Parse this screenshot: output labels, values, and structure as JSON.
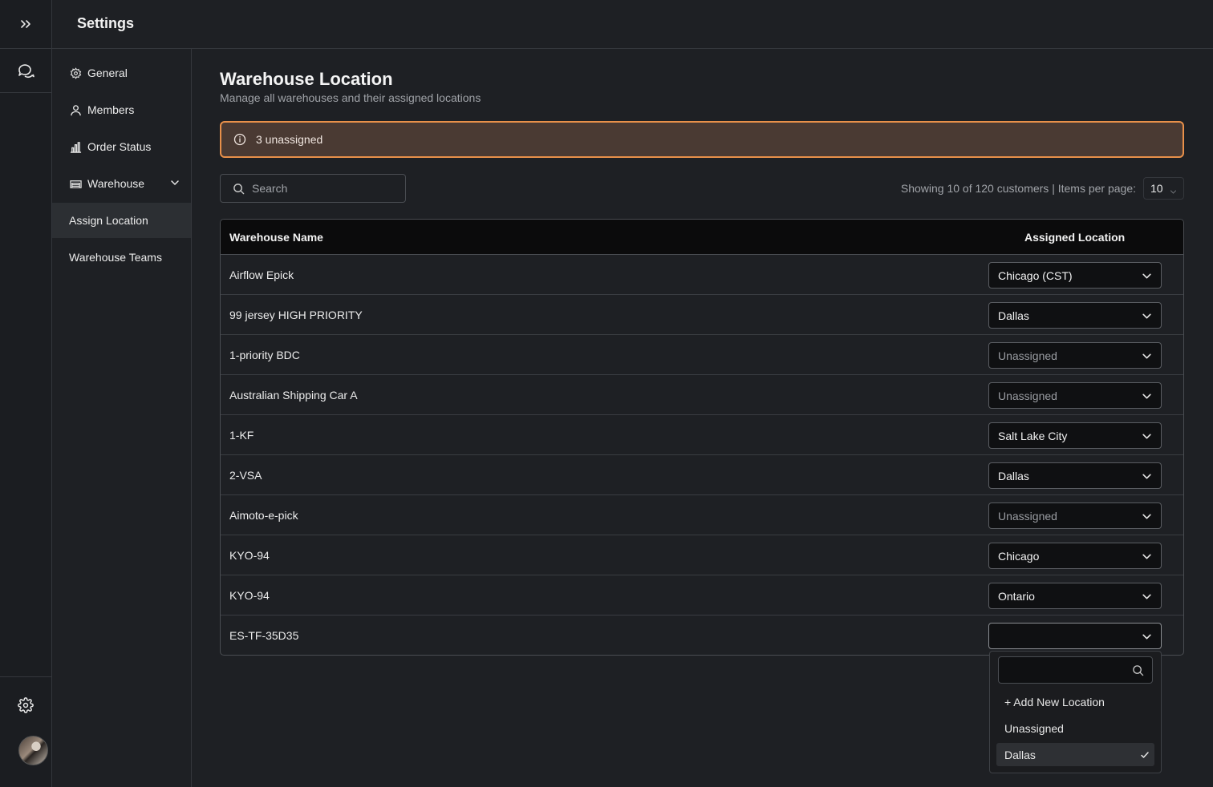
{
  "header": {
    "title": "Settings"
  },
  "subnav": {
    "items": [
      {
        "label": "General",
        "icon": "gear-icon"
      },
      {
        "label": "Members",
        "icon": "user-icon"
      },
      {
        "label": "Order Status",
        "icon": "bar-chart-icon"
      },
      {
        "label": "Warehouse",
        "icon": "warehouse-icon"
      },
      {
        "label": "Assign Location"
      },
      {
        "label": "Warehouse Teams"
      }
    ]
  },
  "page": {
    "title": "Warehouse Location",
    "subtitle": "Manage all warehouses and their assigned locations"
  },
  "alert": {
    "text": "3 unassigned",
    "accent": "#e8904a"
  },
  "search": {
    "placeholder": "Search"
  },
  "pagination": {
    "showing": "Showing 10 of 120 customers | Items per page:",
    "per_page": "10"
  },
  "table": {
    "headers": {
      "name": "Warehouse Name",
      "location": "Assigned Location"
    },
    "rows": [
      {
        "name": "Airflow Epick",
        "location": "Chicago (CST)"
      },
      {
        "name": "99 jersey HIGH PRIORITY",
        "location": "Dallas"
      },
      {
        "name": "1-priority BDC",
        "location": "Unassigned"
      },
      {
        "name": "Australian Shipping Car A",
        "location": "Unassigned"
      },
      {
        "name": "1-KF",
        "location": "Salt Lake City"
      },
      {
        "name": "2-VSA",
        "location": "Dallas"
      },
      {
        "name": "Aimoto-e-pick",
        "location": "Unassigned"
      },
      {
        "name": "KYO-94",
        "location": "Chicago"
      },
      {
        "name": "KYO-94",
        "location": "Ontario"
      },
      {
        "name": "ES-TF-35D35",
        "location": ""
      }
    ]
  },
  "dropdown": {
    "items": [
      {
        "label": "+ Add New Location"
      },
      {
        "label": "Unassigned"
      },
      {
        "label": "Dallas",
        "selected": true
      }
    ]
  }
}
